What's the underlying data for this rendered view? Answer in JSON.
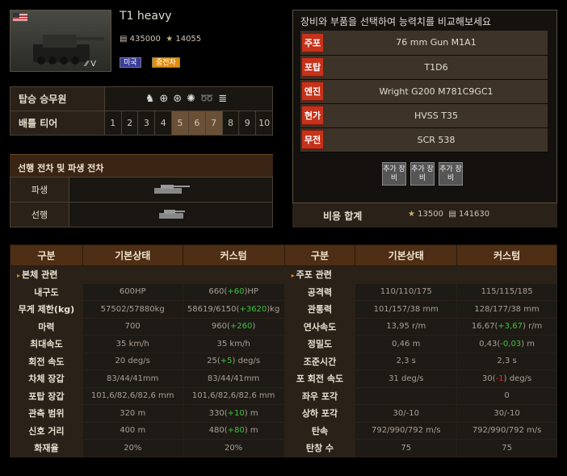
{
  "tank": {
    "name": "T1 heavy",
    "price_silver": "435000",
    "price_xp": "14055",
    "tier_roman": "V",
    "nation": "미국",
    "class": "중전차"
  },
  "crew": {
    "label": "탑승 승무원",
    "icons": [
      "commander-icon",
      "gunner-icon",
      "driver-icon",
      "radio-icon",
      "loader-icon",
      "loader2-icon"
    ]
  },
  "tier": {
    "label": "배틀 티어",
    "values": [
      "1",
      "2",
      "3",
      "4",
      "5",
      "6",
      "7",
      "8",
      "9",
      "10"
    ],
    "highlighted": [
      "5",
      "6",
      "7"
    ]
  },
  "lineage": {
    "title": "선행 전차 및 파생 전차",
    "next_label": "파생",
    "prev_label": "선행"
  },
  "modules": {
    "title": "장비와 부품을 선택하여 능력치를 비교해보세요",
    "rows": [
      {
        "tag": "주포",
        "value": "76 mm Gun M1A1"
      },
      {
        "tag": "포탑",
        "value": "T1D6"
      },
      {
        "tag": "엔진",
        "value": "Wright G200 M781C9GC1"
      },
      {
        "tag": "현가",
        "value": "HVSS T35"
      },
      {
        "tag": "무전",
        "value": "SCR 538"
      }
    ],
    "equip_label": "추가 장비",
    "cost_label": "비용 합계",
    "cost_xp": "13500",
    "cost_silver": "141630"
  },
  "table": {
    "headers": [
      "구분",
      "기본상태",
      "커스텀",
      "구분",
      "기본상태",
      "커스텀"
    ],
    "left_section": "본체 관련",
    "right_section": "주포 관련",
    "left_rows": [
      {
        "k": "내구도",
        "b": "600HP",
        "c": "660(+60)HP"
      },
      {
        "k": "무게 제한(kg)",
        "b": "57502/57880kg",
        "c": "58619/6150(+3620)kg"
      },
      {
        "k": "마력",
        "b": "700",
        "c": "960(+260)"
      },
      {
        "k": "최대속도",
        "b": "35 km/h",
        "c": "35 km/h"
      },
      {
        "k": "회전 속도",
        "b": "20 deg/s",
        "c": "25(+5) deg/s"
      },
      {
        "k": "차체 장갑",
        "b": "83/44/41mm",
        "c": "83/44/41mm"
      },
      {
        "k": "포탑 장갑",
        "b": "101,6/82,6/82,6 mm",
        "c": "101,6/82,6/82,6 mm"
      },
      {
        "k": "관측 범위",
        "b": "320 m",
        "c": "330(+10) m"
      },
      {
        "k": "신호 거리",
        "b": "400 m",
        "c": "480(+80) m"
      },
      {
        "k": "화재율",
        "b": "20%",
        "c": "20%"
      }
    ],
    "right_rows": [
      {
        "k": "공격력",
        "b": "110/110/175",
        "c": "115/115/185"
      },
      {
        "k": "관통력",
        "b": "101/157/38 mm",
        "c": "128/177/38 mm"
      },
      {
        "k": "연사속도",
        "b": "13,95 r/m",
        "c": "16,67(+3,67) r/m"
      },
      {
        "k": "정밀도",
        "b": "0,46 m",
        "c": "0,43(-0,03) m"
      },
      {
        "k": "조준시간",
        "b": "2,3 s",
        "c": "2,3 s"
      },
      {
        "k": "포 회전 속도",
        "b": "31 deg/s",
        "c": "30(-1) deg/s"
      },
      {
        "k": "좌우 포각",
        "b": "",
        "c": "0"
      },
      {
        "k": "상하 포각",
        "b": "30/-10",
        "c": "30/-10"
      },
      {
        "k": "탄속",
        "b": "792/990/792 m/s",
        "c": "792/990/792 m/s"
      },
      {
        "k": "탄창 수",
        "b": "75",
        "c": "75"
      }
    ]
  }
}
